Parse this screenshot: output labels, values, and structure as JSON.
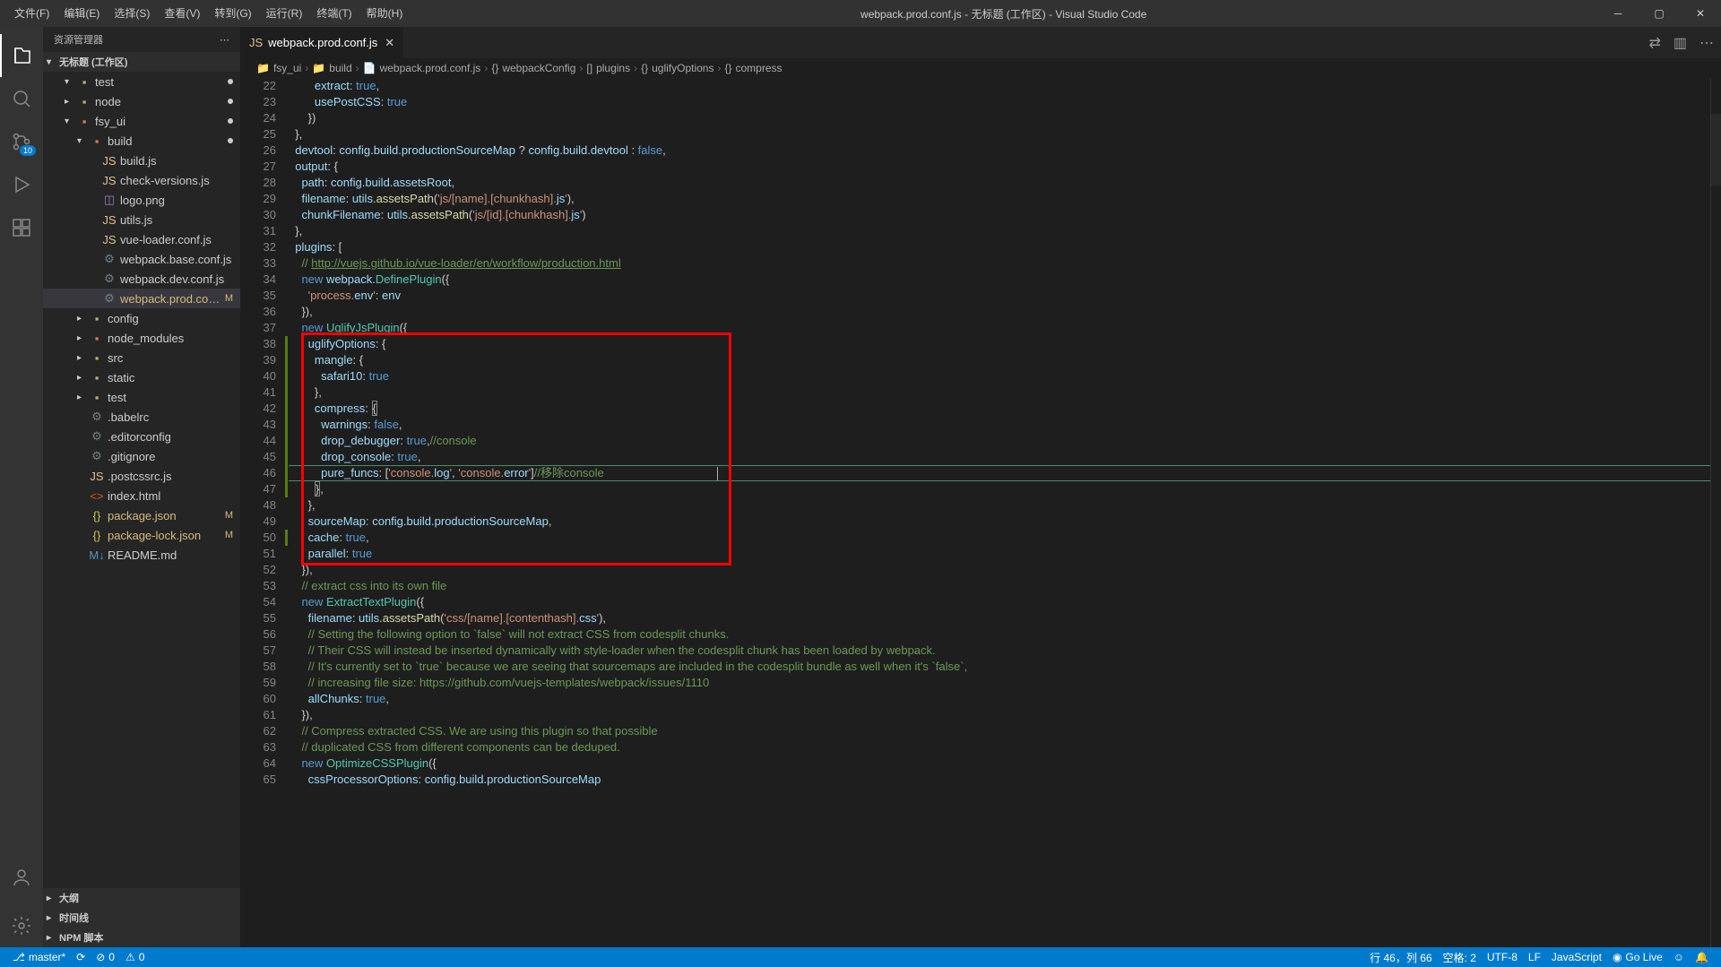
{
  "titlebar": {
    "menus": [
      "文件(F)",
      "编辑(E)",
      "选择(S)",
      "查看(V)",
      "转到(G)",
      "运行(R)",
      "终端(T)",
      "帮助(H)"
    ],
    "title": "webpack.prod.conf.js - 无标题 (工作区) - Visual Studio Code"
  },
  "activity": {
    "badge": "10"
  },
  "sidebar": {
    "header": "资源管理器",
    "workspace": "无标题 (工作区)",
    "tree": [
      {
        "kind": "folder",
        "label": "test",
        "indent": 1,
        "open": true,
        "dot": true
      },
      {
        "kind": "folder",
        "label": "node",
        "indent": 1,
        "open": false,
        "dot": true
      },
      {
        "kind": "folder",
        "label": "fsy_ui",
        "indent": 1,
        "open": true,
        "dot": true,
        "git": true
      },
      {
        "kind": "folder",
        "label": "build",
        "indent": 2,
        "open": true,
        "dot": true,
        "git": true
      },
      {
        "kind": "file",
        "label": "build.js",
        "indent": 3,
        "icon": "js"
      },
      {
        "kind": "file",
        "label": "check-versions.js",
        "indent": 3,
        "icon": "js"
      },
      {
        "kind": "file",
        "label": "logo.png",
        "indent": 3,
        "icon": "png"
      },
      {
        "kind": "file",
        "label": "utils.js",
        "indent": 3,
        "icon": "js"
      },
      {
        "kind": "file",
        "label": "vue-loader.conf.js",
        "indent": 3,
        "icon": "js"
      },
      {
        "kind": "file",
        "label": "webpack.base.conf.js",
        "indent": 3,
        "icon": "conf"
      },
      {
        "kind": "file",
        "label": "webpack.dev.conf.js",
        "indent": 3,
        "icon": "conf"
      },
      {
        "kind": "file",
        "label": "webpack.prod.conf.js",
        "indent": 3,
        "icon": "conf",
        "selected": true,
        "status": "M",
        "modified": true
      },
      {
        "kind": "folder",
        "label": "config",
        "indent": 2,
        "open": false
      },
      {
        "kind": "folder",
        "label": "node_modules",
        "indent": 2,
        "open": false,
        "git": true
      },
      {
        "kind": "folder",
        "label": "src",
        "indent": 2,
        "open": false
      },
      {
        "kind": "folder",
        "label": "static",
        "indent": 2,
        "open": false
      },
      {
        "kind": "folder",
        "label": "test",
        "indent": 2,
        "open": false
      },
      {
        "kind": "file",
        "label": ".babelrc",
        "indent": 2,
        "icon": "conf"
      },
      {
        "kind": "file",
        "label": ".editorconfig",
        "indent": 2,
        "icon": "conf"
      },
      {
        "kind": "file",
        "label": ".gitignore",
        "indent": 2,
        "icon": "conf"
      },
      {
        "kind": "file",
        "label": ".postcssrc.js",
        "indent": 2,
        "icon": "js"
      },
      {
        "kind": "file",
        "label": "index.html",
        "indent": 2,
        "icon": "html"
      },
      {
        "kind": "file",
        "label": "package.json",
        "indent": 2,
        "icon": "json",
        "status": "M",
        "modified": true
      },
      {
        "kind": "file",
        "label": "package-lock.json",
        "indent": 2,
        "icon": "json",
        "status": "M",
        "modified": true
      },
      {
        "kind": "file",
        "label": "README.md",
        "indent": 2,
        "icon": "md"
      }
    ],
    "sections": [
      "大纲",
      "时间线",
      "NPM 脚本"
    ]
  },
  "tab": {
    "label": "webpack.prod.conf.js"
  },
  "breadcrumbs": [
    "fsy_ui",
    "build",
    "webpack.prod.conf.js",
    "webpackConfig",
    "plugins",
    "uglifyOptions",
    "compress"
  ],
  "code": {
    "startLine": 22,
    "lines": [
      "        extract: true,",
      "        usePostCSS: true",
      "      })",
      "  },",
      "  devtool: config.build.productionSourceMap ? config.build.devtool : false,",
      "  output: {",
      "    path: config.build.assetsRoot,",
      "    filename: utils.assetsPath('js/[name].[chunkhash].js'),",
      "    chunkFilename: utils.assetsPath('js/[id].[chunkhash].js')",
      "  },",
      "  plugins: [",
      "    // http://vuejs.github.io/vue-loader/en/workflow/production.html",
      "    new webpack.DefinePlugin({",
      "      'process.env': env",
      "    }),",
      "    new UglifyJsPlugin({",
      "      uglifyOptions: {",
      "        mangle: {",
      "          safari10: true",
      "        },",
      "        compress: {",
      "          warnings: false,",
      "          drop_debugger: true,//console",
      "          drop_console: true,",
      "          pure_funcs: ['console.log', 'console.error']//移除console",
      "        },",
      "      },",
      "      sourceMap: config.build.productionSourceMap,",
      "      cache: true,",
      "      parallel: true",
      "    }),",
      "    // extract css into its own file",
      "    new ExtractTextPlugin({",
      "      filename: utils.assetsPath('css/[name].[contenthash].css'),",
      "      // Setting the following option to `false` will not extract CSS from codesplit chunks.",
      "      // Their CSS will instead be inserted dynamically with style-loader when the codesplit chunk has been loaded by webpack.",
      "      // It's currently set to `true` because we are seeing that sourcemaps are included in the codesplit bundle as well when it's `false`,",
      "      // increasing file size: https://github.com/vuejs-templates/webpack/issues/1110",
      "      allChunks: true,",
      "    }),",
      "    // Compress extracted CSS. We are using this plugin so that possible",
      "    // duplicated CSS from different components can be deduped.",
      "    new OptimizeCSSPlugin({",
      "      cssProcessorOptions: config.build.productionSourceMap"
    ],
    "highlightStartLine": 38,
    "highlightEndLine": 51,
    "cursorLine": 46
  },
  "statusbar": {
    "branch": "master*",
    "sync": "",
    "errors": "0",
    "warnings": "0",
    "position": "行 46，列 66",
    "spaces": "空格: 2",
    "encoding": "UTF-8",
    "eol": "LF",
    "language": "JavaScript",
    "golive": "Go Live"
  }
}
